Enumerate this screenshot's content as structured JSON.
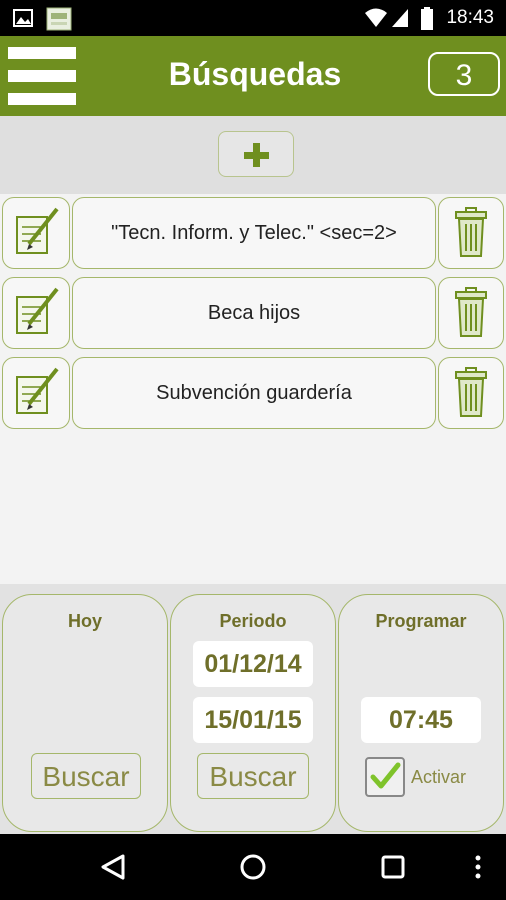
{
  "status_bar": {
    "time": "18:43"
  },
  "header": {
    "title": "Búsquedas",
    "count": "3"
  },
  "searches": [
    {
      "label": "\"Tecn. Inform. y Telec.\" <sec=2>"
    },
    {
      "label": "Beca hijos"
    },
    {
      "label": "Subvención guardería"
    }
  ],
  "panels": {
    "hoy": {
      "title": "Hoy",
      "search_label": "Buscar"
    },
    "periodo": {
      "title": "Periodo",
      "start_date": "01/12/14",
      "end_date": "15/01/15",
      "search_label": "Buscar"
    },
    "programar": {
      "title": "Programar",
      "time": "07:45",
      "activate_label": "Activar",
      "activated": true
    }
  },
  "colors": {
    "accent": "#6f8f1f",
    "border": "#a5b76b",
    "text_olive": "#6f6f2a"
  },
  "icons": [
    "image-icon",
    "app-notification-icon",
    "wifi-icon",
    "signal-icon",
    "battery-icon",
    "menu-icon",
    "plus-icon",
    "edit-icon",
    "trash-icon",
    "checkbox-icon",
    "back-icon",
    "home-icon",
    "recents-icon",
    "more-icon"
  ]
}
